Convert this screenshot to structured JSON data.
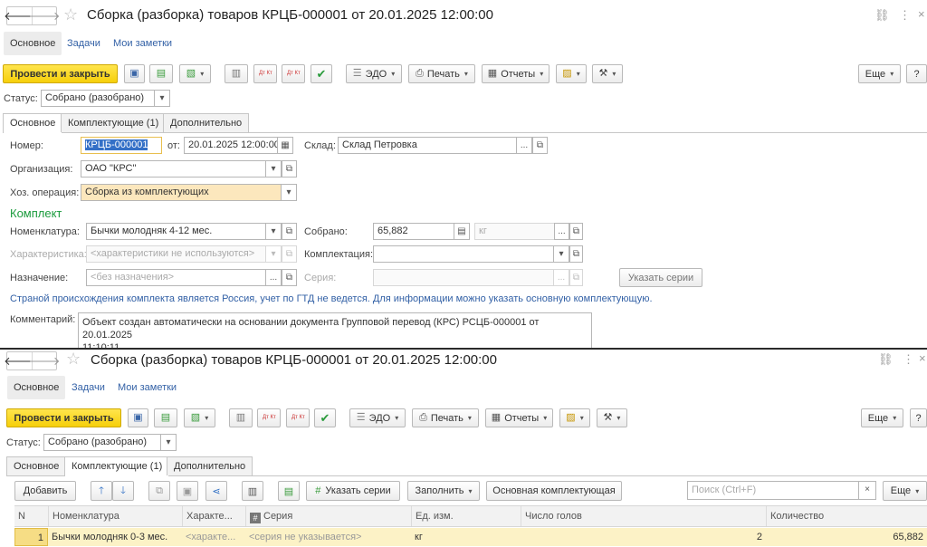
{
  "window": {
    "title": "Сборка (разборка) товаров КРЦБ-000001 от 20.01.2025 12:00:00",
    "link_icon": "⛓",
    "more_icon": "⋮",
    "close_icon": "×"
  },
  "section_tabs": [
    "Основное",
    "Задачи",
    "Мои заметки"
  ],
  "toolbar": {
    "post_close": "Провести и закрыть",
    "edo": "ЭДО",
    "print": "Печать",
    "reports": "Отчеты",
    "more": "Еще",
    "help": "?",
    "dt_kt_a": "Дт Кт",
    "dt_kt_b": "Дт Кт"
  },
  "status": {
    "label": "Статус:",
    "value": "Собрано (разобрано)"
  },
  "form_tabs": [
    "Основное",
    "Комплектующие (1)",
    "Дополнительно"
  ],
  "form": {
    "number_label": "Номер:",
    "number_value": "КРЦБ-000001",
    "date_label": "от:",
    "date_value": "20.01.2025 12:00:00",
    "warehouse_label": "Склад:",
    "warehouse_value": "Склад Петровка",
    "org_label": "Организация:",
    "org_value": "ОАО \"КРС\"",
    "operation_label": "Хоз. операция:",
    "operation_value": "Сборка из комплектующих",
    "kit_title": "Комплект",
    "nomenclature_label": "Номенклатура:",
    "nomenclature_value": "Бычки молодняк 4-12 мес.",
    "assembled_label": "Собрано:",
    "assembled_value": "65,882",
    "unit_value": "кг",
    "characteristic_label": "Характеристика:",
    "characteristic_placeholder": "<характеристики не используются>",
    "kitting_label": "Комплектация:",
    "purpose_label": "Назначение:",
    "purpose_placeholder": "<без назначения>",
    "series_label": "Серия:",
    "specify_series": "Указать серии",
    "info_text": "Страной происхождения комплекта является Россия, учет по ГТД не ведется. Для информации можно указать основную комплектующую.",
    "comment_label": "Комментарий:",
    "comment_line1": "Объект создан автоматически на основании документа Групповой перевод (КРС) РСЦБ-000001 от 20.01.2025",
    "comment_line2": "11:10:11"
  },
  "components_toolbar": {
    "add": "Добавить",
    "specify_series": "Указать серии",
    "fill": "Заполнить",
    "main_component": "Основная комплектующая",
    "search_placeholder": "Поиск (Ctrl+F)",
    "more": "Еще"
  },
  "table": {
    "columns": [
      "N",
      "Номенклатура",
      "Характе...",
      "Серия",
      "Ед. изм.",
      "Число голов",
      "Количество"
    ],
    "rows": [
      {
        "n": "1",
        "nomenclature": "Бычки молодняк 0-3 мес.",
        "characteristic": "<характе...",
        "series": "<серия не указывается>",
        "unit": "кг",
        "heads": "2",
        "quantity": "65,882"
      }
    ]
  },
  "colors": {
    "accent": "#f6cf0a",
    "link": "#3361a6",
    "section": "#1a9b3c",
    "highlight": "#fce7bd",
    "row": "#fcf2c6"
  }
}
